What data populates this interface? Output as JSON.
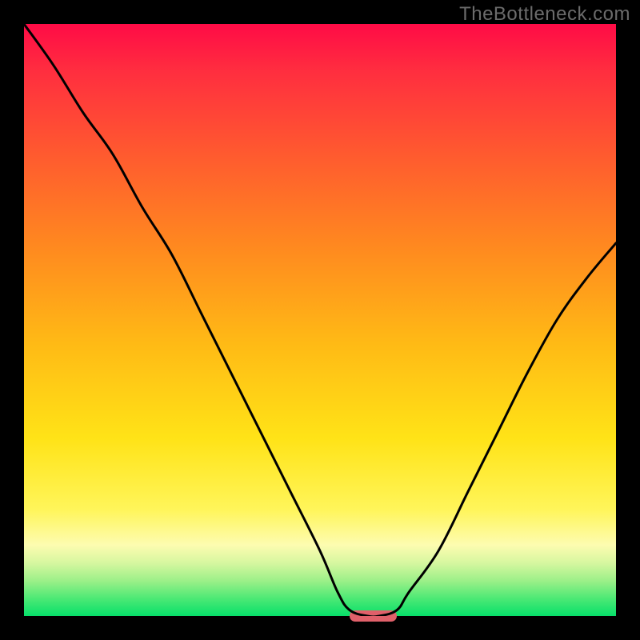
{
  "watermark": "TheBottleneck.com",
  "colors": {
    "frame": "#000000",
    "curve": "#000000",
    "marker": "#e0606a"
  },
  "chart_data": {
    "type": "line",
    "title": "",
    "xlabel": "",
    "ylabel": "",
    "xlim": [
      0,
      100
    ],
    "ylim": [
      0,
      100
    ],
    "grid": false,
    "legend": false,
    "series": [
      {
        "name": "bottleneck-curve",
        "x": [
          0,
          5,
          10,
          15,
          20,
          25,
          30,
          35,
          40,
          45,
          50,
          53,
          55,
          58,
          60,
          63,
          65,
          70,
          75,
          80,
          85,
          90,
          95,
          100
        ],
        "y": [
          100,
          93,
          85,
          78,
          69,
          61,
          51,
          41,
          31,
          21,
          11,
          4,
          1,
          0,
          0,
          1,
          4,
          11,
          21,
          31,
          41,
          50,
          57,
          63
        ]
      }
    ],
    "marker": {
      "x_start": 55,
      "x_end": 63,
      "y": 0
    },
    "background_gradient": {
      "stops": [
        {
          "pos": 0.0,
          "color": "#ff0b46"
        },
        {
          "pos": 0.08,
          "color": "#ff2e3f"
        },
        {
          "pos": 0.22,
          "color": "#ff5a2f"
        },
        {
          "pos": 0.38,
          "color": "#ff8a1f"
        },
        {
          "pos": 0.54,
          "color": "#ffba15"
        },
        {
          "pos": 0.7,
          "color": "#ffe317"
        },
        {
          "pos": 0.82,
          "color": "#fff55a"
        },
        {
          "pos": 0.88,
          "color": "#fdfcb0"
        },
        {
          "pos": 0.91,
          "color": "#d7f7a0"
        },
        {
          "pos": 0.94,
          "color": "#9df089"
        },
        {
          "pos": 0.97,
          "color": "#4de975"
        },
        {
          "pos": 1.0,
          "color": "#07e06a"
        }
      ]
    }
  }
}
